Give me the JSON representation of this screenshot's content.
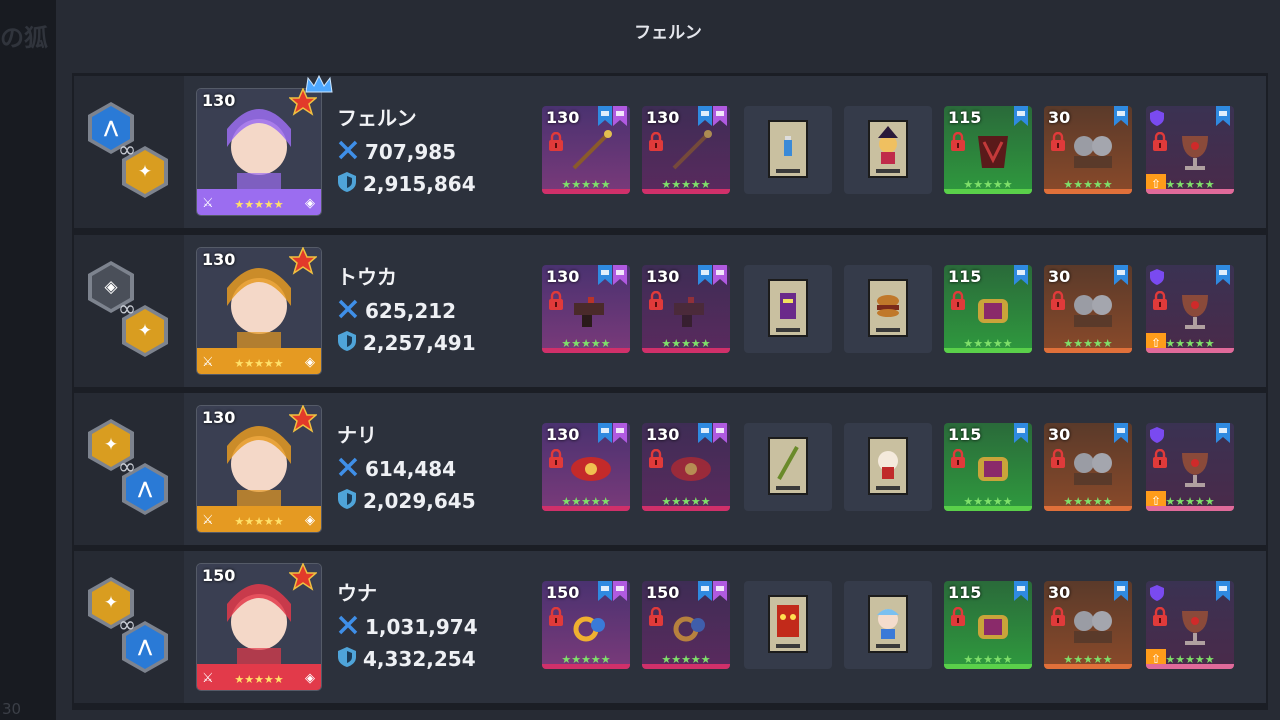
{
  "background": {
    "text_fragment": "の狐",
    "corner_number": "30"
  },
  "panel": {
    "title": "フェルン"
  },
  "colors": {
    "attack_icon": "#3f8fe8",
    "defense_icon": "#4fa4d9",
    "weapon_slot": "#6e3a8c",
    "green_slot": "#2b8a3a",
    "orange_slot": "#7a4a2a",
    "accent_blue": "#2a7ad6",
    "accent_gold": "#d99d20"
  },
  "heroes": [
    {
      "name": "フェルン",
      "level": "130",
      "attack": "707,985",
      "defense": "2,915,864",
      "stars": "★★★★★",
      "frame_color": "#9b6df0",
      "has_crown": true,
      "links": [
        {
          "icon": "wing-icon",
          "color": "blue"
        },
        {
          "icon": "stars-icon",
          "color": "gold"
        }
      ],
      "equipment": [
        {
          "kind": "weapon",
          "level": "130",
          "stars": "★★★★★",
          "icon": "staff-icon",
          "dim": false
        },
        {
          "kind": "weapon",
          "level": "130",
          "stars": "★★★★★",
          "icon": "staff-icon",
          "dim": true
        },
        {
          "kind": "card",
          "icon": "potion-card-icon"
        },
        {
          "kind": "card",
          "icon": "witch-card-icon"
        },
        {
          "kind": "green",
          "level": "115",
          "stars": "★★★★★",
          "icon": "cloak-icon"
        },
        {
          "kind": "orange",
          "level": "30",
          "stars": "★★★★★",
          "icon": "gargoyle-icon"
        },
        {
          "kind": "relic",
          "stars": "★★★★★",
          "icon": "chalice-icon"
        }
      ]
    },
    {
      "name": "トウカ",
      "level": "130",
      "attack": "625,212",
      "defense": "2,257,491",
      "stars": "★★★★★",
      "frame_color": "#e59a22",
      "has_crown": false,
      "links": [
        {
          "icon": "dice-icon",
          "color": "gray"
        },
        {
          "icon": "stars-icon",
          "color": "gold"
        }
      ],
      "equipment": [
        {
          "kind": "weapon",
          "level": "130",
          "stars": "★★★★★",
          "icon": "gun-icon",
          "dim": false
        },
        {
          "kind": "weapon",
          "level": "130",
          "stars": "★★★★★",
          "icon": "gun-icon",
          "dim": true
        },
        {
          "kind": "card",
          "icon": "knight-card-icon"
        },
        {
          "kind": "card",
          "icon": "burger-card-icon"
        },
        {
          "kind": "green",
          "level": "115",
          "stars": "★★★★★",
          "icon": "scroll-icon"
        },
        {
          "kind": "orange",
          "level": "30",
          "stars": "★★★★★",
          "icon": "gargoyle-icon"
        },
        {
          "kind": "relic",
          "stars": "★★★★★",
          "icon": "chalice-icon"
        }
      ]
    },
    {
      "name": "ナリ",
      "level": "130",
      "attack": "614,484",
      "defense": "2,029,645",
      "stars": "★★★★★",
      "frame_color": "#e59a22",
      "has_crown": false,
      "links": [
        {
          "icon": "stars-icon",
          "color": "gold"
        },
        {
          "icon": "wing-icon",
          "color": "blue"
        }
      ],
      "equipment": [
        {
          "kind": "weapon",
          "level": "130",
          "stars": "★★★★★",
          "icon": "crab-icon",
          "dim": false
        },
        {
          "kind": "weapon",
          "level": "130",
          "stars": "★★★★★",
          "icon": "crab-icon",
          "dim": true
        },
        {
          "kind": "card",
          "icon": "spear-card-icon"
        },
        {
          "kind": "card",
          "icon": "cat-card-icon"
        },
        {
          "kind": "green",
          "level": "115",
          "stars": "★★★★★",
          "icon": "scroll-icon"
        },
        {
          "kind": "orange",
          "level": "30",
          "stars": "★★★★★",
          "icon": "gargoyle-icon"
        },
        {
          "kind": "relic",
          "stars": "★★★★★",
          "icon": "chalice-icon"
        }
      ]
    },
    {
      "name": "ウナ",
      "level": "150",
      "attack": "1,031,974",
      "defense": "4,332,254",
      "stars": "★★★★★",
      "frame_color": "#e23a4a",
      "has_crown": false,
      "links": [
        {
          "icon": "stars-icon",
          "color": "gold"
        },
        {
          "icon": "wing-icon",
          "color": "blue"
        }
      ],
      "equipment": [
        {
          "kind": "weapon",
          "level": "150",
          "stars": "★★★★★",
          "icon": "ring-icon",
          "dim": false
        },
        {
          "kind": "weapon",
          "level": "150",
          "stars": "★★★★★",
          "icon": "ring-icon",
          "dim": true
        },
        {
          "kind": "card",
          "icon": "demon-card-icon"
        },
        {
          "kind": "card",
          "icon": "girl-card-icon"
        },
        {
          "kind": "green",
          "level": "115",
          "stars": "★★★★★",
          "icon": "scroll-icon"
        },
        {
          "kind": "orange",
          "level": "30",
          "stars": "★★★★★",
          "icon": "gargoyle-icon"
        },
        {
          "kind": "relic",
          "stars": "★★★★★",
          "icon": "chalice-icon"
        }
      ]
    }
  ]
}
